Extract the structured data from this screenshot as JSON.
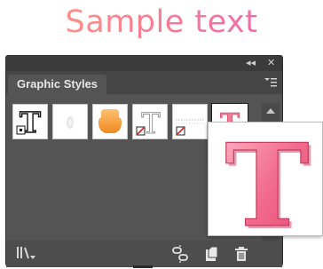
{
  "sample": {
    "text": "Sample text"
  },
  "panel": {
    "collapse_glyph": "◂◂",
    "close_glyph": "✕",
    "tab_label": "Graphic Styles",
    "swatches": [
      {
        "name": "default-t-style"
      },
      {
        "name": "light-glow-style"
      },
      {
        "name": "orange-bevel-style"
      },
      {
        "name": "outlined-t-style"
      },
      {
        "name": "dotted-line-style"
      },
      {
        "name": "pink-3d-t-style",
        "selected": true
      }
    ],
    "bottom_icons": [
      "graphic-styles-libraries-menu-icon",
      "break-link-icon",
      "new-graphic-style-icon",
      "delete-icon"
    ]
  },
  "preview": {
    "glyph": "T",
    "color": "#f06a8c"
  },
  "colors": {
    "panel_bg": "#545454",
    "title_bar": "#3b3b3b",
    "sample_gradient": [
      "#ff8f88",
      "#f06ea7"
    ]
  }
}
